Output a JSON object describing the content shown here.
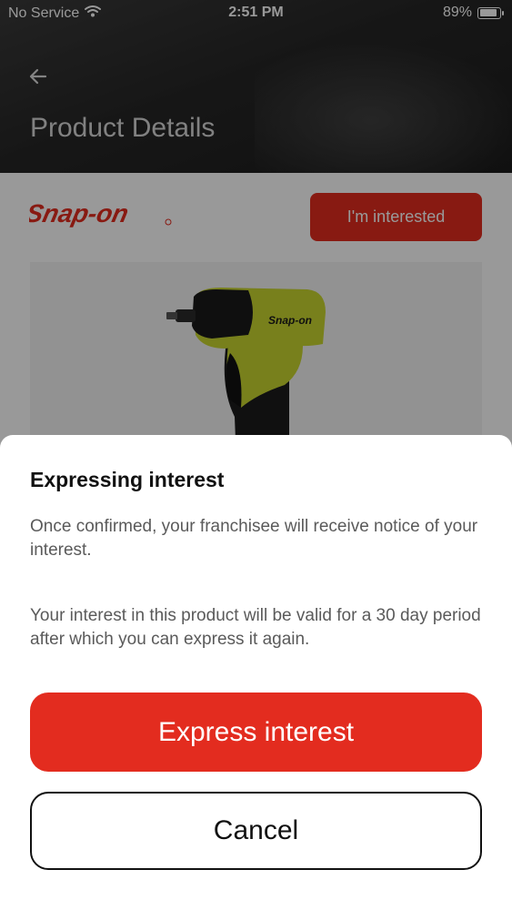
{
  "status_bar": {
    "carrier": "No Service",
    "time": "2:51 PM",
    "battery": "89%",
    "battery_level": 0.89
  },
  "header": {
    "back_icon": "arrow-left-icon",
    "title": "Product Details"
  },
  "product": {
    "brand": "Snap-on",
    "interest_button_label": "I'm interested",
    "image": "yellow-cordless-impact-wrench"
  },
  "sheet": {
    "title": "Expressing interest",
    "paragraph_1": "Once confirmed, your franchisee will receive notice of your interest.",
    "paragraph_2": "Your interest in this product will be valid for a 30 day period after which you can express it again.",
    "express_button_label": "Express interest",
    "cancel_button_label": "Cancel"
  },
  "colors": {
    "accent": "#e32c1f",
    "header_bg": "#262626",
    "sheet_bg": "#ffffff"
  }
}
